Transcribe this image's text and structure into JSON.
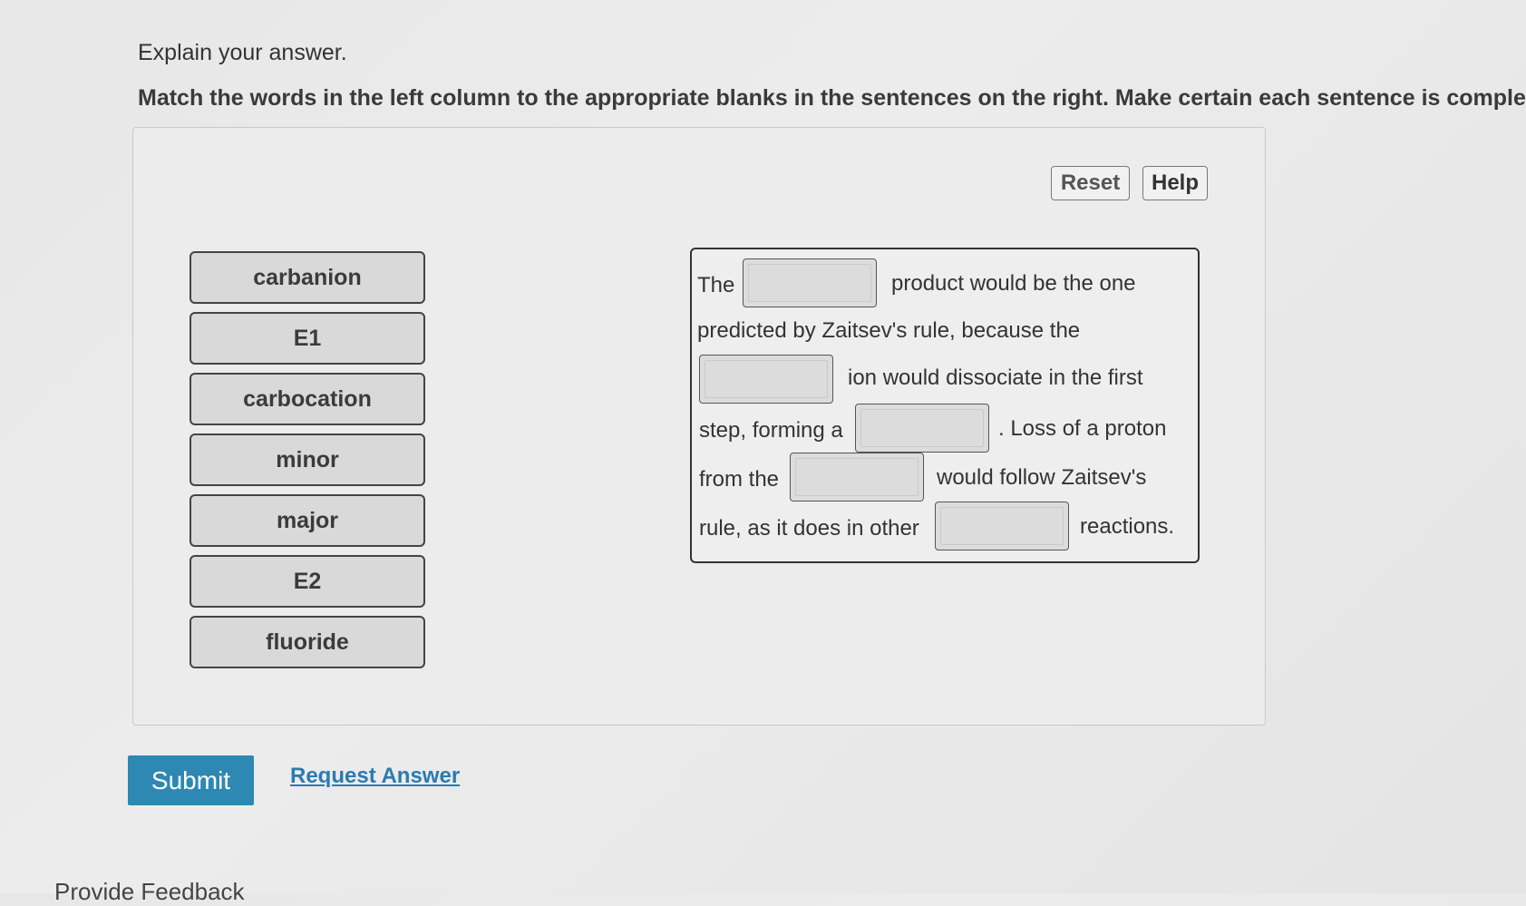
{
  "heading": "Explain your answer.",
  "instructions": "Match the words in the left column to the appropriate blanks in the sentences on the right. Make certain each sentence is complet",
  "toolbar": {
    "reset_label": "Reset",
    "help_label": "Help"
  },
  "word_bank": [
    "carbanion",
    "E1",
    "carbocation",
    "minor",
    "major",
    "E2",
    "fluoride"
  ],
  "sentence": {
    "seg1": "The",
    "seg2": "product would be the one",
    "seg3": "predicted by Zaitsev's rule, because the",
    "seg4": "ion would dissociate in the first",
    "seg5": "step, forming a",
    "seg6": ". Loss of a proton",
    "seg7": "from the",
    "seg8": "would follow Zaitsev's",
    "seg9": "rule, as it does in other",
    "seg10": "reactions."
  },
  "actions": {
    "submit_label": "Submit",
    "request_answer_label": "Request Answer"
  },
  "footer": {
    "partial_text": "Provide Feedback"
  }
}
